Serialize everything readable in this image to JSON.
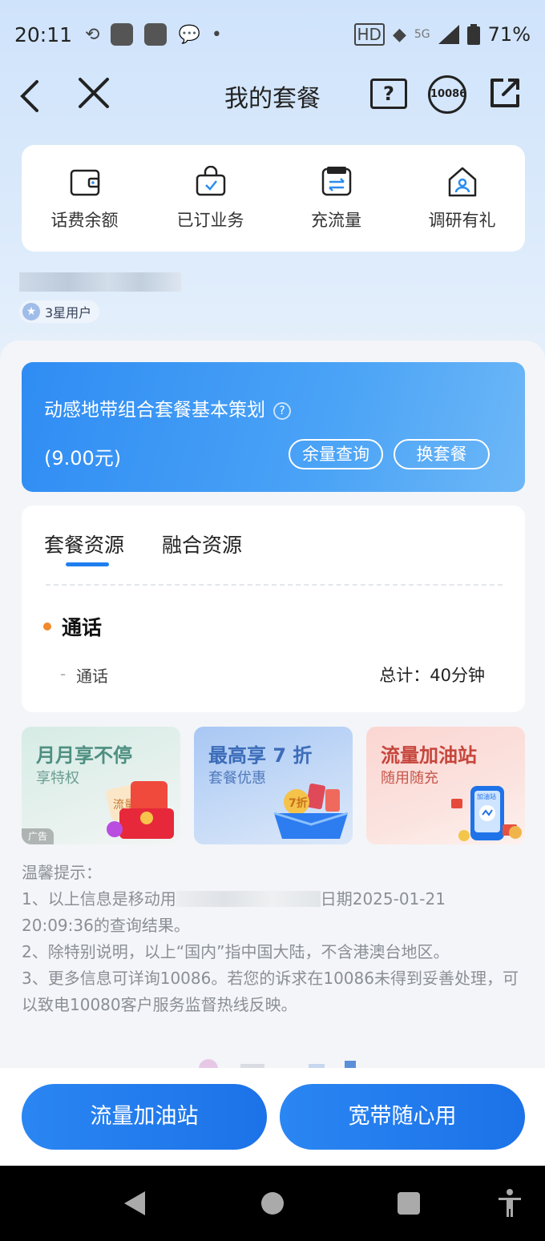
{
  "status_bar": {
    "time": "20:11",
    "network": "5G",
    "battery": "71%"
  },
  "nav": {
    "title": "我的套餐",
    "help_glyph": "?",
    "hotline": "10086"
  },
  "quick_actions": [
    {
      "label": "话费余额",
      "icon": "wallet-icon"
    },
    {
      "label": "已订业务",
      "icon": "bag-check-icon"
    },
    {
      "label": "充流量",
      "icon": "data-recharge-icon"
    },
    {
      "label": "调研有礼",
      "icon": "survey-user-icon"
    }
  ],
  "user": {
    "level": "3星用户"
  },
  "plan": {
    "name": "动感地带组合套餐基本策划",
    "price": "(9.00元)",
    "balance_button": "余量查询",
    "change_button": "换套餐"
  },
  "resources": {
    "tabs": [
      "套餐资源",
      "融合资源"
    ],
    "active_tab": 0,
    "category": "通话",
    "rows": [
      {
        "label": "通话",
        "value": "总计：40分钟"
      }
    ]
  },
  "promos": [
    {
      "title": "月月享不停",
      "subtitle": "享特权",
      "ad_tag": "广告",
      "art_text": "流量"
    },
    {
      "title": "最高享 7 折",
      "subtitle": "套餐优惠",
      "art_text": "7折"
    },
    {
      "title": "流量加油站",
      "subtitle": "随用随充",
      "art_text": "加油站"
    }
  ],
  "tips": {
    "heading": "温馨提示：",
    "line1_a": "1、以上信息是移动用",
    "line1_b": "日期2025-01-21",
    "line1_c": "20:09:36的查询结果。",
    "line2": "2、除特别说明，以上“国内”指中国大陆，不含港澳台地区。",
    "line3": "3、更多信息可详询10086。若您的诉求在10086未得到妥善处理，可以致电10080客户服务监督热线反映。"
  },
  "actions": {
    "left": "流量加油站",
    "right": "宽带随心用"
  },
  "colors": {
    "accent": "#1f7ef0",
    "plan_card": "#3a96f4",
    "dot": "#f08a2c"
  }
}
